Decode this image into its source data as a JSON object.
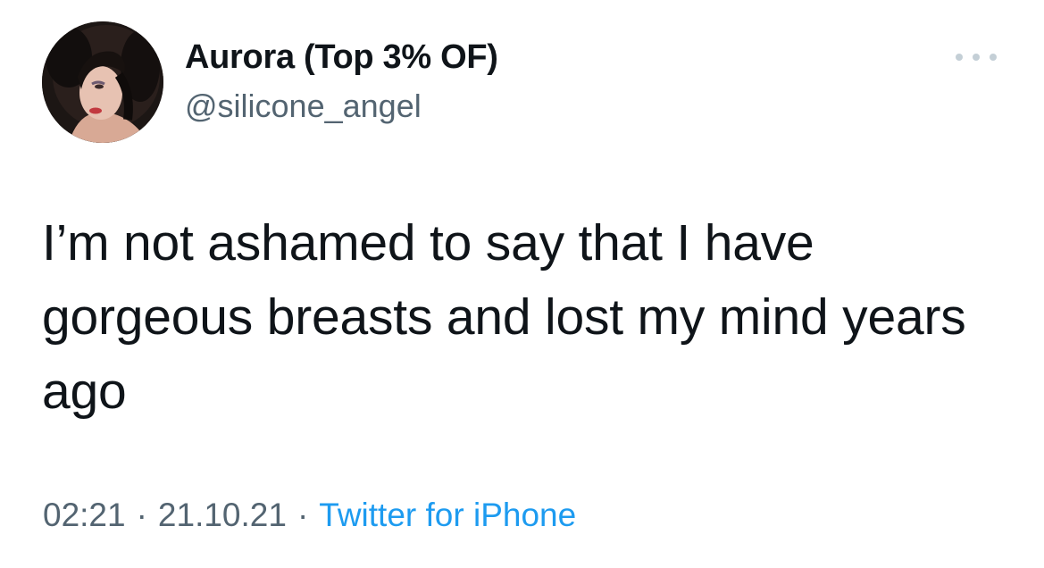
{
  "author": {
    "display_name": "Aurora (Top 3% OF)",
    "handle": "@silicone_angel",
    "avatar_icon": "profile-photo"
  },
  "tweet": {
    "text": "I’m not ashamed to say that I have gorgeous breasts and lost my mind years ago",
    "time": "02:21",
    "separator": "·",
    "date": "21.10.21",
    "source": "Twitter for iPhone"
  },
  "menu": {
    "icon": "more-options-icon"
  },
  "colors": {
    "text": "#0f1419",
    "secondary": "#536471",
    "link": "#1d9bf0",
    "menu_dots": "#c4cfd6"
  }
}
